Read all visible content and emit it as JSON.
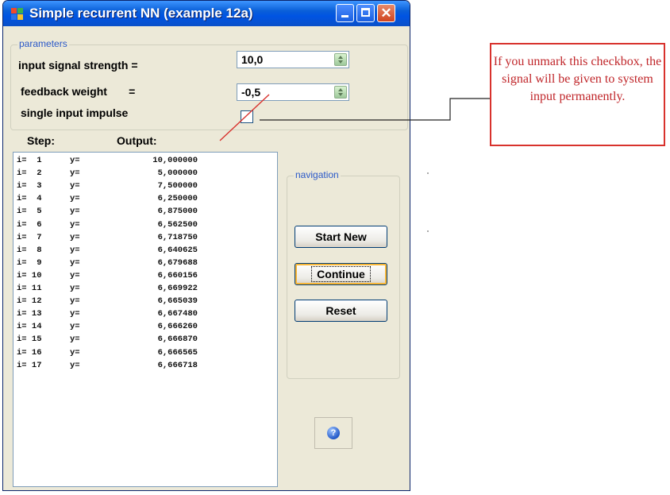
{
  "window": {
    "title": "Simple recurrent NN (example 12a)"
  },
  "parameters": {
    "legend": "parameters",
    "input_signal_strength": {
      "label": "input signal strength  =",
      "value": "10,0"
    },
    "feedback_weight": {
      "label": "feedback weight       =",
      "value": "-0,5"
    },
    "single_input_impulse": {
      "label": "single input impulse",
      "checked": false
    }
  },
  "output": {
    "step_header": "Step:",
    "output_header": "Output:",
    "rows": [
      {
        "i": "i=  1",
        "y": "y=",
        "value": "10,000000"
      },
      {
        "i": "i=  2",
        "y": "y=",
        "value": "5,000000"
      },
      {
        "i": "i=  3",
        "y": "y=",
        "value": "7,500000"
      },
      {
        "i": "i=  4",
        "y": "y=",
        "value": "6,250000"
      },
      {
        "i": "i=  5",
        "y": "y=",
        "value": "6,875000"
      },
      {
        "i": "i=  6",
        "y": "y=",
        "value": "6,562500"
      },
      {
        "i": "i=  7",
        "y": "y=",
        "value": "6,718750"
      },
      {
        "i": "i=  8",
        "y": "y=",
        "value": "6,640625"
      },
      {
        "i": "i=  9",
        "y": "y=",
        "value": "6,679688"
      },
      {
        "i": "i= 10",
        "y": "y=",
        "value": "6,660156"
      },
      {
        "i": "i= 11",
        "y": "y=",
        "value": "6,669922"
      },
      {
        "i": "i= 12",
        "y": "y=",
        "value": "6,665039"
      },
      {
        "i": "i= 13",
        "y": "y=",
        "value": "6,667480"
      },
      {
        "i": "i= 14",
        "y": "y=",
        "value": "6,666260"
      },
      {
        "i": "i= 15",
        "y": "y=",
        "value": "6,666870"
      },
      {
        "i": "i= 16",
        "y": "y=",
        "value": "6,666565"
      },
      {
        "i": "i= 17",
        "y": "y=",
        "value": "6,666718"
      }
    ]
  },
  "navigation": {
    "legend": "navigation",
    "start_new": "Start New",
    "continue": "Continue",
    "reset": "Reset"
  },
  "callout": {
    "text": "If you unmark this checkbox, the signal will be given to system input permanently."
  },
  "colors": {
    "titlebar": "#0054e3",
    "annotation": "#d8322d",
    "legend": "#2a58c8"
  }
}
